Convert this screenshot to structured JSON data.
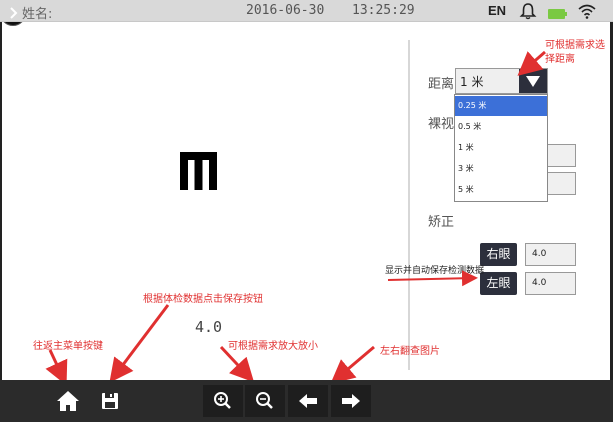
{
  "status_bar": {
    "name_label": "姓名:",
    "date": "2016-06-30",
    "time": "13:25:29",
    "language": "EN"
  },
  "main": {
    "acuity_value": "4.0"
  },
  "settings": {
    "distance_label": "距离",
    "distance_value": "1 米",
    "distance_options": [
      "0.25 米",
      "0.5 米",
      "1 米",
      "3 米",
      "5 米"
    ],
    "selected_option": "0.25 米",
    "visual_label": "裸视",
    "corrected_label": "矫正",
    "right_eye_label": "右眼",
    "left_eye_label": "左眼",
    "right_eye_value": "4.0",
    "left_eye_value": "4.0"
  },
  "annotations": {
    "distance_note_line1": "可根据需求选",
    "distance_note_line2": "择距离",
    "save_data_note": "显示并自动保存检测数据",
    "save_button_note": "根据体检数据点击保存按钮",
    "home_note": "往返主菜单按键",
    "zoom_note": "可根据需求放大放小",
    "page_note": "左右翻查图片"
  },
  "toolbar": {
    "icons": [
      "chevron-right-icon",
      "home-icon",
      "save-icon",
      "zoom-in-icon",
      "zoom-out-icon",
      "arrow-left-icon",
      "arrow-right-icon"
    ]
  },
  "colors": {
    "toolbar_bg": "#2b2b2b",
    "button_dark": "#2c2f3c",
    "selected_option_bg": "#3c70d8",
    "annotation_red": "#e03030",
    "battery_green": "#7ac943"
  }
}
